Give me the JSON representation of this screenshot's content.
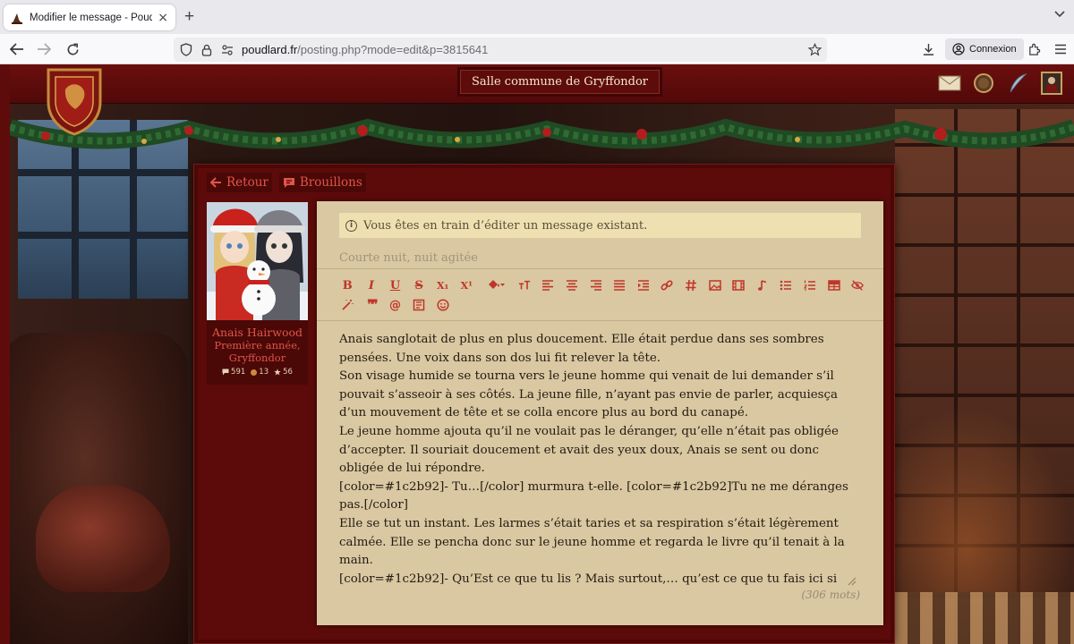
{
  "browser": {
    "tab_title": "Modifier le message - Poudlard.",
    "tab_close": "×",
    "new_tab": "+",
    "url_domain": "poudlard.fr",
    "url_path": "/posting.php?mode=edit&p=3815641",
    "signin_label": "Connexion"
  },
  "header": {
    "room_title": "Salle commune de Gryffondor"
  },
  "panel": {
    "back_label": "Retour",
    "drafts_label": "Brouillons"
  },
  "user": {
    "name": "Anais Hairwood",
    "year": "Première année,",
    "house": "Gryffondor",
    "posts": "591",
    "points": "13",
    "stars": "56"
  },
  "editor": {
    "notice": "Vous êtes en train d’éditer un message existant.",
    "subject_placeholder": "Courte nuit, nuit agitée",
    "body": "Anais sanglotait de plus en plus doucement. Elle était perdue dans ses sombres pensées. Une voix dans son dos lui fit relever la tête.\nSon visage humide se tourna vers le jeune homme qui venait de lui demander s’il pouvait s’asseoir à ses côtés. La jeune fille, n’ayant pas envie de parler, acquiesça d’un mouvement de tête et se colla encore plus au bord du canapé.\nLe jeune homme ajouta qu’il ne voulait pas le déranger, qu’elle n’était pas obligée d’accepter. Il souriait doucement et avait des yeux doux, Anais se sent ou donc obligée de lui répondre.\n[color=#1c2b92]- Tu…[/color] murmura t-elle. [color=#1c2b92]Tu ne me déranges pas.[/color]\nElle se tut un instant. Les larmes s’était taries et sa respiration s’était légèrement calmée. Elle se pencha donc sur le jeune homme et regarda le livre qu’il tenait à la main.\n[color=#1c2b92]- Qu’Est ce que tu lis ? Mais surtout,… qu’est ce que tu fais ici si tard. Il est bientôt une heure du mat’.[/color]\nLa jeune fille fronça les sourcils. Ce garçon n’avait pas l’air d’avoir fait un cauchemar, il était tranquille. Jamais encore, elle n’avait croisé quelqu’un lors de ses terreurs nocturnes. Rien",
    "word_count": "(306 mots)"
  },
  "toolbar": {
    "bold": "B",
    "italic": "I",
    "underline": "U",
    "strike": "S",
    "subscript": "X₁",
    "superscript": "X¹",
    "quote": "❞❞",
    "mention": "@"
  },
  "colors": {
    "accent_red": "#c0352a",
    "panel_red": "#5c0b0a",
    "parchment": "#d9c8a2",
    "notice_bg": "#efe0b2"
  }
}
